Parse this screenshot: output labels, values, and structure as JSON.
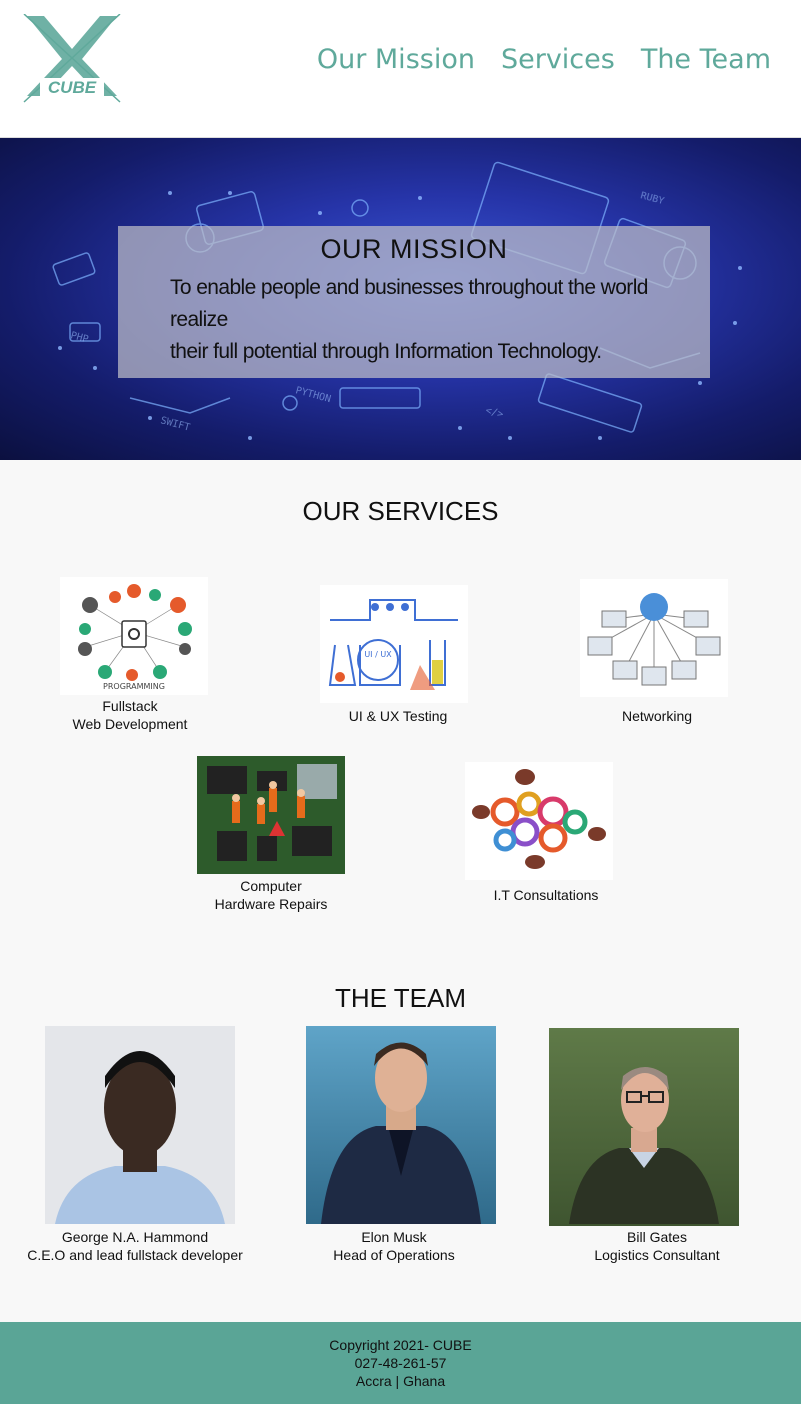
{
  "brand": {
    "logo_text": "CUBE",
    "accent": "#5fa99b"
  },
  "nav": {
    "items": [
      "Our Mission",
      "Services",
      "The Team"
    ]
  },
  "hero": {
    "title": "OUR MISSION",
    "line1": "To enable people and businesses throughout  the world realize",
    "line2": "their full potential through Information Technology."
  },
  "services": {
    "title": "OUR SERVICES",
    "items": [
      {
        "line1": "Fullstack",
        "line2": "Web Development",
        "icon": "programming-icon",
        "img_text": "PROGRAMMING"
      },
      {
        "line1": "UI & UX Testing",
        "line2": "",
        "icon": "lab-testing-icon",
        "img_text": "UI / UX"
      },
      {
        "line1": "Networking",
        "line2": "",
        "icon": "network-icon"
      },
      {
        "line1": "Computer",
        "line2": "Hardware Repairs",
        "icon": "circuit-board-icon"
      },
      {
        "line1": "I.T Consultations",
        "line2": "",
        "icon": "gears-icon"
      }
    ]
  },
  "team": {
    "title": "THE TEAM",
    "members": [
      {
        "name": "George N.A. Hammond",
        "role": "C.E.O and lead fullstack developer",
        "bg": "#e4e6ea"
      },
      {
        "name": "Elon Musk",
        "role": "Head of Operations",
        "bg": "#3f7fa0"
      },
      {
        "name": "Bill Gates",
        "role": "Logistics Consultant",
        "bg": "#556b3c"
      }
    ]
  },
  "footer": {
    "copyright": "Copyright 2021- CUBE",
    "phone": "027-48-261-57",
    "location": "Accra | Ghana",
    "bg": "#5aa596"
  }
}
